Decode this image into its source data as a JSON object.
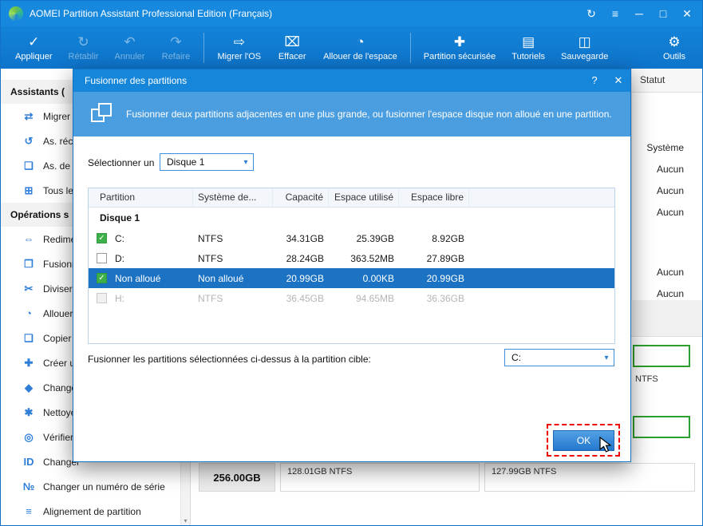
{
  "window": {
    "title": "AOMEI Partition Assistant Professional Edition (Français)"
  },
  "icons": {
    "refresh": "↻",
    "menu": "≡",
    "minimize": "─",
    "maximize": "□",
    "close": "✕",
    "apply": "✓",
    "restore": "↻",
    "undo": "↶",
    "redo": "↷",
    "migrate": "⇨",
    "erase": "⌧",
    "allocate": "◔",
    "secure": "✚",
    "tutorials": "▤",
    "backup": "◫",
    "tools": "⚙",
    "help": "?",
    "dialog_close": "✕",
    "combo_arrow": "▾",
    "check": "✓",
    "scroll_down": "▾"
  },
  "toolbar": {
    "items": [
      {
        "label": "Appliquer",
        "enabled": true
      },
      {
        "label": "Rétablir",
        "enabled": false
      },
      {
        "label": "Annuler",
        "enabled": false
      },
      {
        "label": "Refaire",
        "enabled": false
      },
      {
        "label": "Migrer l'OS",
        "enabled": true
      },
      {
        "label": "Effacer",
        "enabled": true
      },
      {
        "label": "Allouer de l'espace",
        "enabled": true
      },
      {
        "label": "Partition sécurisée",
        "enabled": true
      },
      {
        "label": "Tutoriels",
        "enabled": true
      },
      {
        "label": "Sauvegarde",
        "enabled": true
      },
      {
        "label": "Outils",
        "enabled": true
      }
    ]
  },
  "sidebar": {
    "sections": [
      {
        "header": "Assistants (",
        "items": [
          {
            "glyph": "⇄",
            "label": "Migrer l'O"
          },
          {
            "glyph": "↺",
            "label": "As. récu"
          },
          {
            "glyph": "❏",
            "label": "As. de c"
          },
          {
            "glyph": "⊞",
            "label": "Tous les"
          }
        ]
      },
      {
        "header": "Opérations s",
        "items": [
          {
            "glyph": "⇔",
            "label": "Redimen"
          },
          {
            "glyph": "❒",
            "label": "Fusionne"
          },
          {
            "glyph": "✂",
            "label": "Diviser u"
          },
          {
            "glyph": "◔",
            "label": "Allouer d"
          },
          {
            "glyph": "❏",
            "label": "Copier u"
          },
          {
            "glyph": "✚",
            "label": "Créer un"
          },
          {
            "glyph": "◆",
            "label": "Changer"
          },
          {
            "glyph": "✱",
            "label": "Nettoyer"
          },
          {
            "glyph": "◎",
            "label": "Vérifier l"
          },
          {
            "glyph": "ID",
            "label": "Changer"
          },
          {
            "glyph": "№",
            "label": "Changer un numéro de série"
          },
          {
            "glyph": "≡",
            "label": "Alignement de partition"
          }
        ]
      }
    ]
  },
  "main": {
    "statut_header": "Statut",
    "statut": [
      "Système",
      "Aucun",
      "Aucun",
      "Aucun",
      "Aucun",
      "Aucun"
    ],
    "disk1_fs": "NTFS",
    "disk2_capacity": "256.00GB",
    "disk2_part1": "128.01GB NTFS",
    "disk2_part2": "127.99GB NTFS"
  },
  "dialog": {
    "title": "Fusionner des partitions",
    "banner": "Fusionner deux partitions adjacentes en une plus grande, ou fusionner l'espace disque non alloué en une partition.",
    "select_label": "Sélectionner un",
    "disk_combo": "Disque 1",
    "table": {
      "columns": [
        "Partition",
        "Système de...",
        "Capacité",
        "Espace utilisé",
        "Espace libre"
      ],
      "group": "Disque 1",
      "rows": [
        {
          "checked": true,
          "state": "normal",
          "partition": "C:",
          "fs": "NTFS",
          "capacity": "34.31GB",
          "used": "25.39GB",
          "free": "8.92GB"
        },
        {
          "checked": false,
          "state": "normal",
          "partition": "D:",
          "fs": "NTFS",
          "capacity": "28.24GB",
          "used": "363.52MB",
          "free": "27.89GB"
        },
        {
          "checked": true,
          "state": "selected",
          "partition": "Non alloué",
          "fs": "Non alloué",
          "capacity": "20.99GB",
          "used": "0.00KB",
          "free": "20.99GB"
        },
        {
          "checked": false,
          "state": "disabled",
          "partition": "H:",
          "fs": "NTFS",
          "capacity": "36.45GB",
          "used": "94.65MB",
          "free": "36.36GB"
        }
      ]
    },
    "target_label": "Fusionner les partitions sélectionnées ci-dessus à la partition cible:",
    "target_combo": "C:",
    "ok": "OK"
  },
  "colors": {
    "titlebar_blue": "#1688dd",
    "dialog_header_blue": "#1586d9",
    "banner_blue": "#4a9ddf",
    "selected_row_blue": "#1c73c4",
    "checkbox_green": "#3eb049",
    "partition_border_green": "#2ca02c",
    "annotation_red": "#f00000"
  }
}
